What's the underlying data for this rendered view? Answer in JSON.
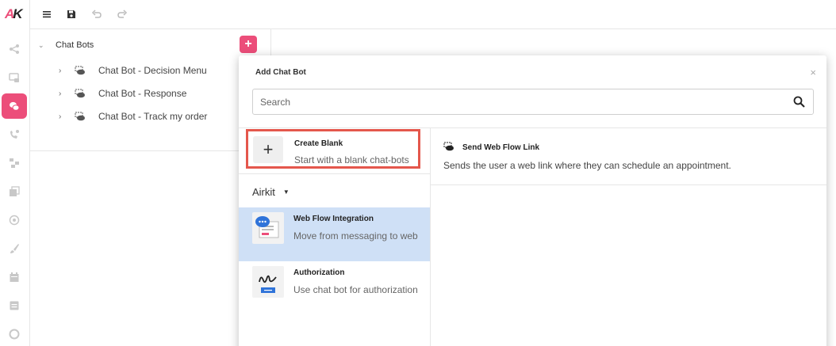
{
  "app": {
    "logo_text_a": "A",
    "logo_text_k": "K",
    "accent": "#ec4e7a"
  },
  "rail": {
    "items": [
      {
        "icon": "share-nodes-icon"
      },
      {
        "icon": "screen-chat-icon"
      },
      {
        "icon": "chat-bubbles-icon",
        "active": true
      },
      {
        "icon": "phone-flow-icon"
      },
      {
        "icon": "flow-steps-icon"
      },
      {
        "icon": "gallery-icon"
      },
      {
        "icon": "cube-icon"
      },
      {
        "icon": "brush-icon"
      },
      {
        "icon": "calendar-icon"
      },
      {
        "icon": "list-icon"
      },
      {
        "icon": "circle-icon"
      }
    ]
  },
  "toolbar": {
    "menu": "menu-icon",
    "save": "save-icon",
    "undo": "undo-icon",
    "redo": "redo-icon"
  },
  "tree": {
    "root_label": "Chat Bots",
    "add_label": "+",
    "items": [
      {
        "label": "Chat Bot - Decision Menu"
      },
      {
        "label": "Chat Bot - Response"
      },
      {
        "label": "Chat Bot - Track my order"
      }
    ]
  },
  "modal": {
    "title": "Add Chat Bot",
    "close_label": "×",
    "search": {
      "placeholder": "Search",
      "value": ""
    },
    "create_blank": {
      "plus": "+",
      "title": "Create Blank",
      "description": "Start with a blank chat-bots"
    },
    "category": {
      "label": "Airkit"
    },
    "templates": [
      {
        "title": "Web Flow Integration",
        "description": "Move from messaging to web",
        "selected": true
      },
      {
        "title": "Authorization",
        "description": "Use chat bot for authorization",
        "selected": false
      }
    ],
    "results": [
      {
        "title": "Send Web Flow Link",
        "description": "Sends the user a web link where they can schedule an appointment."
      }
    ]
  }
}
